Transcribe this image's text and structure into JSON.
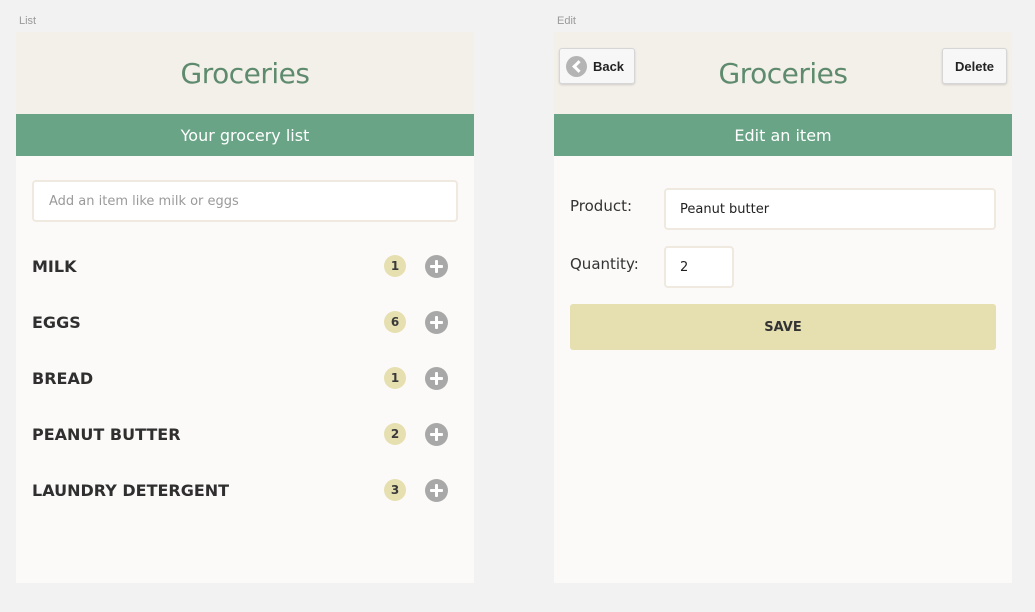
{
  "labels": {
    "list_screen": "List",
    "edit_screen": "Edit"
  },
  "list_view": {
    "app_title": "Groceries",
    "subheader": "Your grocery list",
    "add_item": {
      "placeholder": "Add an item like milk or eggs",
      "value": ""
    },
    "items": [
      {
        "name": "MILK",
        "quantity": "1"
      },
      {
        "name": "EGGS",
        "quantity": "6"
      },
      {
        "name": "BREAD",
        "quantity": "1"
      },
      {
        "name": "PEANUT BUTTER",
        "quantity": "2"
      },
      {
        "name": "LAUNDRY DETERGENT",
        "quantity": "3"
      }
    ]
  },
  "edit_view": {
    "app_title": "Groceries",
    "back_label": "Back",
    "delete_label": "Delete",
    "subheader": "Edit an item",
    "product_label": "Product:",
    "product_value": "Peanut butter",
    "quantity_label": "Quantity:",
    "quantity_value": "2",
    "save_label": "SAVE"
  },
  "colors": {
    "header_bg": "#f3efe9",
    "title_green": "#5e8b6e",
    "subheader_green": "#69a486",
    "badge_bg": "#e6dfb0",
    "add_icon": "#a8a8a8",
    "save_bg": "#e6dfb0"
  },
  "icons": {
    "add": "plus-circle-icon",
    "back": "chevron-left-circle-icon"
  }
}
